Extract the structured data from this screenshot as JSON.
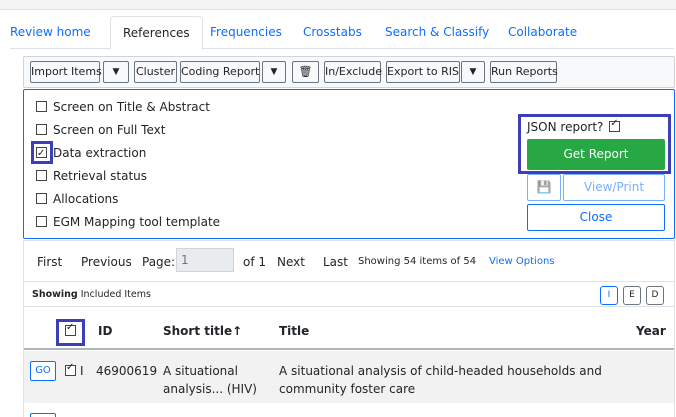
{
  "tabs": [
    {
      "label": "Review home"
    },
    {
      "label": "References"
    },
    {
      "label": "Frequencies"
    },
    {
      "label": "Crosstabs"
    },
    {
      "label": "Search & Classify"
    },
    {
      "label": "Collaborate"
    }
  ],
  "active_tab": "References",
  "toolbar": {
    "import_items": "Import Items",
    "caret": "▼",
    "cluster": "Cluster",
    "coding_report": "Coding Report",
    "trash_icon": "🗑",
    "in_exclude": "In/Exclude",
    "export_ris": "Export to RIS",
    "run_reports": "Run Reports"
  },
  "report_options": [
    {
      "label": "Screen on Title & Abstract",
      "checked": false
    },
    {
      "label": "Screen on Full Text",
      "checked": false
    },
    {
      "label": "Data extraction",
      "checked": true
    },
    {
      "label": "Retrieval status",
      "checked": false
    },
    {
      "label": "Allocations",
      "checked": false
    },
    {
      "label": "EGM Mapping tool template",
      "checked": false
    }
  ],
  "report_panel": {
    "json_label": "JSON report?",
    "json_checked": true,
    "get_report": "Get Report",
    "save_icon": "💾",
    "view_print": "View/Print",
    "close": "Close"
  },
  "pager": {
    "first": "First",
    "previous": "Previous",
    "page_label": "Page:",
    "page_value": "1",
    "of_label": "of 1",
    "next": "Next",
    "last": "Last",
    "showing_count": "Showing 54 items of 54",
    "view_options": "View Options"
  },
  "filter_bar": {
    "showing_bold": "Showing",
    "showing_rest": " Included Items",
    "buttons": [
      "I",
      "E",
      "D"
    ],
    "active": "I"
  },
  "table": {
    "headers": {
      "id": "ID",
      "short_title": "Short title↑",
      "title": "Title",
      "year": "Year"
    },
    "rows": [
      {
        "go": "GO",
        "id": "46900619",
        "short_title_line1": "A situational",
        "short_title_line2": "analysis... (HIV)",
        "title_line1": "A situational analysis of child-headed households and",
        "title_line2": "community foster care",
        "year": ""
      }
    ]
  },
  "colors": {
    "link": "#0d6efd",
    "success": "#28a745",
    "highlight": "#3c3fb5"
  }
}
